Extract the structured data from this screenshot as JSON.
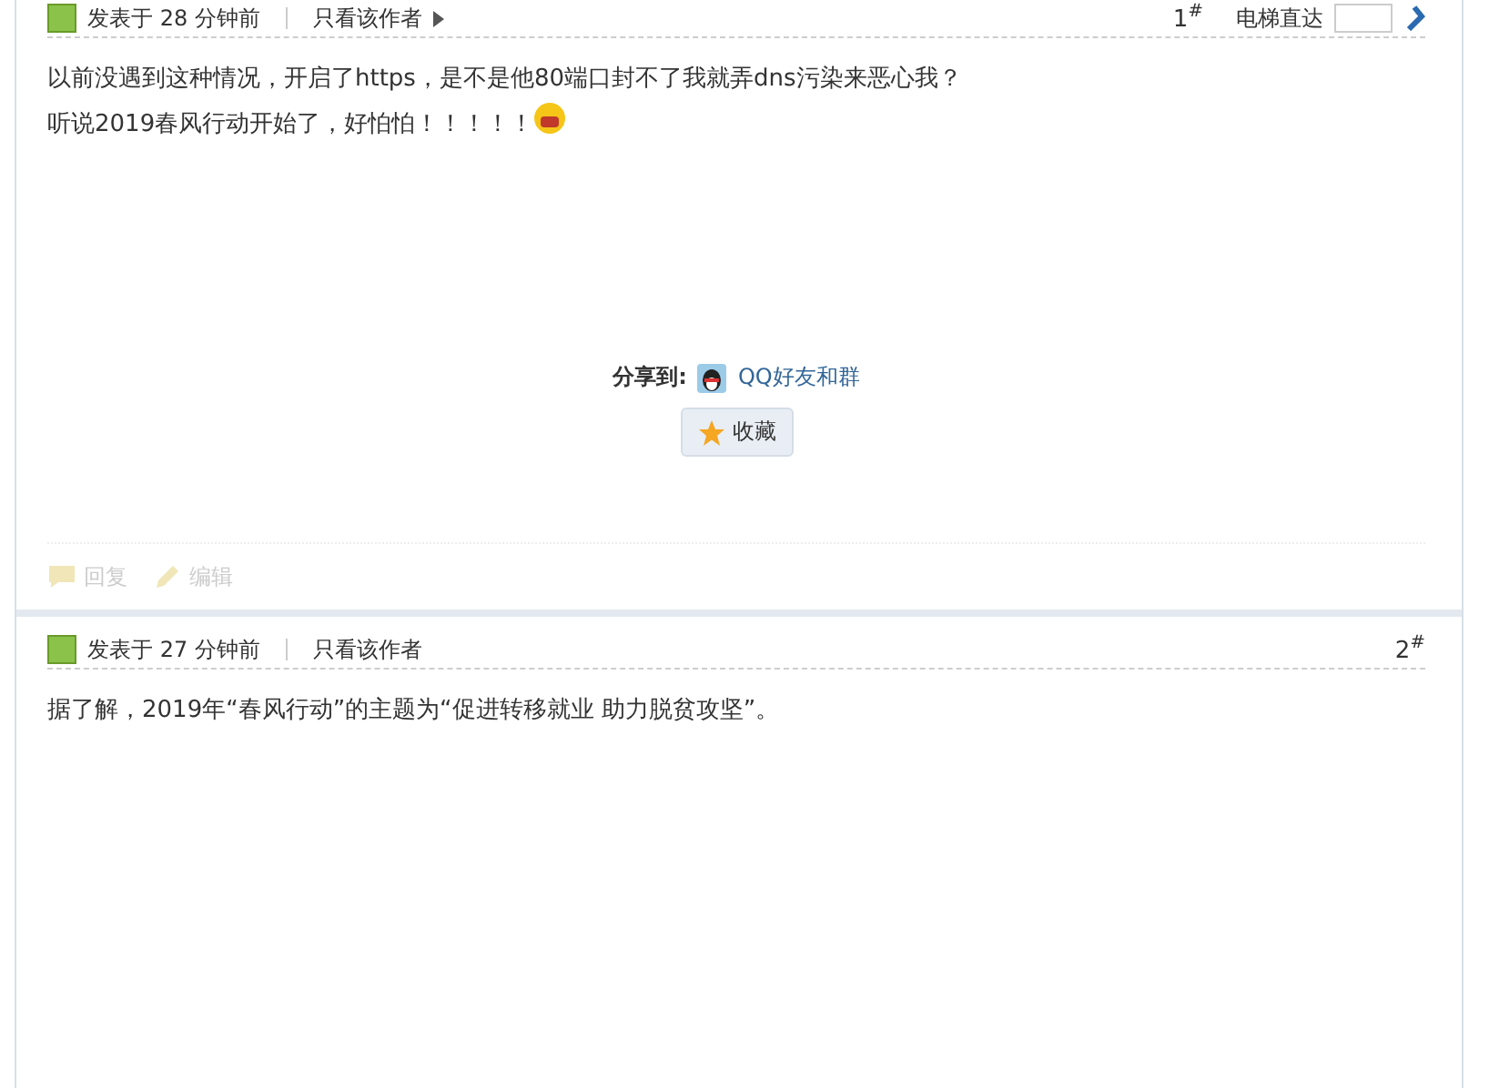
{
  "posts": [
    {
      "meta": "发表于 28 分钟前",
      "author_only": "只看该作者",
      "has_menu_arrow": true,
      "floor": "1",
      "floor_mark": "#",
      "jump": {
        "label": "电梯直达"
      },
      "body": [
        "以前没遇到这种情况，开启了https，是不是他80端口封不了我就弄dns污染来恶心我？",
        "听说2019春风行动开始了，好怕怕！！！！！"
      ],
      "emoticon": true,
      "share": {
        "label": "分享到:",
        "target": "QQ好友和群"
      },
      "favorite": "收藏",
      "actions": [
        {
          "label": "回复",
          "kind": "reply",
          "disabled": true
        },
        {
          "label": "编辑",
          "kind": "edit",
          "disabled": true
        }
      ]
    },
    {
      "meta": "发表于 27 分钟前",
      "author_only": "只看该作者",
      "has_menu_arrow": false,
      "floor": "2",
      "floor_mark": "#",
      "body": [
        "据了解，2019年“春风行动”的主题为“促进转移就业 助力脱贫攻坚”。"
      ],
      "emoticon": false
    }
  ]
}
